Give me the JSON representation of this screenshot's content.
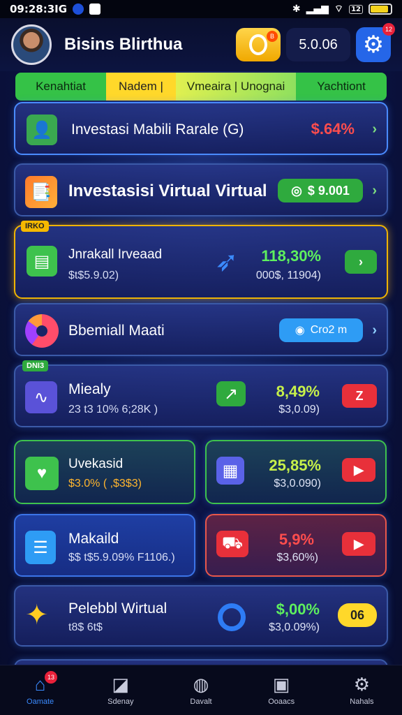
{
  "status_bar": {
    "time": "09:28:3IG",
    "badge": "12"
  },
  "header": {
    "username": "Bisins Blirthua",
    "balance": "5.0.06",
    "coin_badge": "B",
    "settings_badge": "12"
  },
  "tabs": [
    "Kenahtiat",
    "Nadem |",
    "Vmeaira | Unognai",
    "Yachtiont"
  ],
  "cards": {
    "c1": {
      "title": "Investasi  Mabili Rarale (G)",
      "value": "$.64%",
      "value_color": "#ff4d4d"
    },
    "c2": {
      "title": "Investasisi Virtual Virtual",
      "button": "$ 9.001"
    },
    "c3": {
      "tag": "IRKO",
      "title": "Jnrakall Irveaad",
      "sub": "$t$5.9.02)",
      "pct": "118,30%",
      "pct_sub": "000$, 11904)"
    },
    "c4": {
      "title": "Bbemiall Maati",
      "button": "Cro2 m"
    },
    "c5": {
      "tag": "DNI3",
      "title": "Miealy",
      "sub": "23 t3 10% 6;28K )",
      "pct": "8,49%",
      "pct_sub": "$3,0.09)",
      "button": "Z"
    },
    "c6": {
      "title": "Uvekasid",
      "sub": "$3.0% ( ,$3$3)",
      "sub_color": "#ffb52e"
    },
    "c7": {
      "pct": "25,85%",
      "pct_sub": "$3,0.090)"
    },
    "c8": {
      "title": "Makaild",
      "sub": "$$ t$5.9.09% F1106.)"
    },
    "c9": {
      "pct": "5,9%",
      "pct_sub": "$3,60%)"
    },
    "c10": {
      "title": "Pelebbl Wirtual",
      "sub": "t8$ 6t$",
      "pct": "$,00%",
      "pct_sub": "$3,0.09%)",
      "button": "06"
    }
  },
  "nav": {
    "items": [
      {
        "label": "Oamate",
        "icon": "home-icon",
        "badge": "13"
      },
      {
        "label": "Sdenay",
        "icon": "chart-icon"
      },
      {
        "label": "Davalt",
        "icon": "dial-icon"
      },
      {
        "label": "Ooaacs",
        "icon": "clipboard-icon"
      },
      {
        "label": "Nahals",
        "icon": "gear-icon"
      }
    ]
  },
  "colors": {
    "accent_blue": "#2566e8",
    "positive_green": "#5ef05e",
    "negative_red": "#ff4d4d",
    "highlight_yellow": "#ffd82a"
  }
}
